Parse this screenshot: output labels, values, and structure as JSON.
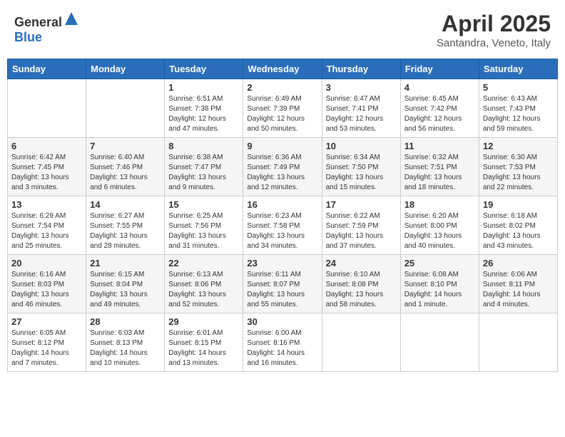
{
  "header": {
    "logo_general": "General",
    "logo_blue": "Blue",
    "title": "April 2025",
    "subtitle": "Santandra, Veneto, Italy"
  },
  "days_of_week": [
    "Sunday",
    "Monday",
    "Tuesday",
    "Wednesday",
    "Thursday",
    "Friday",
    "Saturday"
  ],
  "weeks": [
    [
      {
        "day": "",
        "info": ""
      },
      {
        "day": "",
        "info": ""
      },
      {
        "day": "1",
        "info": "Sunrise: 6:51 AM\nSunset: 7:38 PM\nDaylight: 12 hours\nand 47 minutes."
      },
      {
        "day": "2",
        "info": "Sunrise: 6:49 AM\nSunset: 7:39 PM\nDaylight: 12 hours\nand 50 minutes."
      },
      {
        "day": "3",
        "info": "Sunrise: 6:47 AM\nSunset: 7:41 PM\nDaylight: 12 hours\nand 53 minutes."
      },
      {
        "day": "4",
        "info": "Sunrise: 6:45 AM\nSunset: 7:42 PM\nDaylight: 12 hours\nand 56 minutes."
      },
      {
        "day": "5",
        "info": "Sunrise: 6:43 AM\nSunset: 7:43 PM\nDaylight: 12 hours\nand 59 minutes."
      }
    ],
    [
      {
        "day": "6",
        "info": "Sunrise: 6:42 AM\nSunset: 7:45 PM\nDaylight: 13 hours\nand 3 minutes."
      },
      {
        "day": "7",
        "info": "Sunrise: 6:40 AM\nSunset: 7:46 PM\nDaylight: 13 hours\nand 6 minutes."
      },
      {
        "day": "8",
        "info": "Sunrise: 6:38 AM\nSunset: 7:47 PM\nDaylight: 13 hours\nand 9 minutes."
      },
      {
        "day": "9",
        "info": "Sunrise: 6:36 AM\nSunset: 7:49 PM\nDaylight: 13 hours\nand 12 minutes."
      },
      {
        "day": "10",
        "info": "Sunrise: 6:34 AM\nSunset: 7:50 PM\nDaylight: 13 hours\nand 15 minutes."
      },
      {
        "day": "11",
        "info": "Sunrise: 6:32 AM\nSunset: 7:51 PM\nDaylight: 13 hours\nand 18 minutes."
      },
      {
        "day": "12",
        "info": "Sunrise: 6:30 AM\nSunset: 7:53 PM\nDaylight: 13 hours\nand 22 minutes."
      }
    ],
    [
      {
        "day": "13",
        "info": "Sunrise: 6:29 AM\nSunset: 7:54 PM\nDaylight: 13 hours\nand 25 minutes."
      },
      {
        "day": "14",
        "info": "Sunrise: 6:27 AM\nSunset: 7:55 PM\nDaylight: 13 hours\nand 28 minutes."
      },
      {
        "day": "15",
        "info": "Sunrise: 6:25 AM\nSunset: 7:56 PM\nDaylight: 13 hours\nand 31 minutes."
      },
      {
        "day": "16",
        "info": "Sunrise: 6:23 AM\nSunset: 7:58 PM\nDaylight: 13 hours\nand 34 minutes."
      },
      {
        "day": "17",
        "info": "Sunrise: 6:22 AM\nSunset: 7:59 PM\nDaylight: 13 hours\nand 37 minutes."
      },
      {
        "day": "18",
        "info": "Sunrise: 6:20 AM\nSunset: 8:00 PM\nDaylight: 13 hours\nand 40 minutes."
      },
      {
        "day": "19",
        "info": "Sunrise: 6:18 AM\nSunset: 8:02 PM\nDaylight: 13 hours\nand 43 minutes."
      }
    ],
    [
      {
        "day": "20",
        "info": "Sunrise: 6:16 AM\nSunset: 8:03 PM\nDaylight: 13 hours\nand 46 minutes."
      },
      {
        "day": "21",
        "info": "Sunrise: 6:15 AM\nSunset: 8:04 PM\nDaylight: 13 hours\nand 49 minutes."
      },
      {
        "day": "22",
        "info": "Sunrise: 6:13 AM\nSunset: 8:06 PM\nDaylight: 13 hours\nand 52 minutes."
      },
      {
        "day": "23",
        "info": "Sunrise: 6:11 AM\nSunset: 8:07 PM\nDaylight: 13 hours\nand 55 minutes."
      },
      {
        "day": "24",
        "info": "Sunrise: 6:10 AM\nSunset: 8:08 PM\nDaylight: 13 hours\nand 58 minutes."
      },
      {
        "day": "25",
        "info": "Sunrise: 6:08 AM\nSunset: 8:10 PM\nDaylight: 14 hours\nand 1 minute."
      },
      {
        "day": "26",
        "info": "Sunrise: 6:06 AM\nSunset: 8:11 PM\nDaylight: 14 hours\nand 4 minutes."
      }
    ],
    [
      {
        "day": "27",
        "info": "Sunrise: 6:05 AM\nSunset: 8:12 PM\nDaylight: 14 hours\nand 7 minutes."
      },
      {
        "day": "28",
        "info": "Sunrise: 6:03 AM\nSunset: 8:13 PM\nDaylight: 14 hours\nand 10 minutes."
      },
      {
        "day": "29",
        "info": "Sunrise: 6:01 AM\nSunset: 8:15 PM\nDaylight: 14 hours\nand 13 minutes."
      },
      {
        "day": "30",
        "info": "Sunrise: 6:00 AM\nSunset: 8:16 PM\nDaylight: 14 hours\nand 16 minutes."
      },
      {
        "day": "",
        "info": ""
      },
      {
        "day": "",
        "info": ""
      },
      {
        "day": "",
        "info": ""
      }
    ]
  ]
}
